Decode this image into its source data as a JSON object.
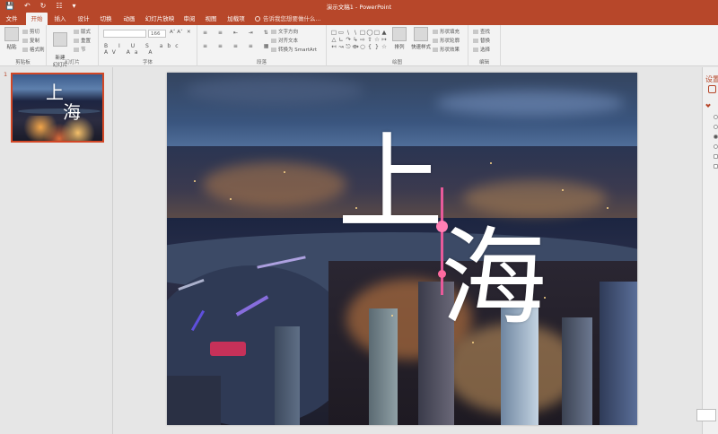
{
  "window": {
    "title": "演示文稿1 - PowerPoint",
    "qat": {
      "save_icon": "save-icon",
      "undo_icon": "undo-icon",
      "redo_icon": "redo-icon",
      "customize_icon": "chevron-down-icon"
    }
  },
  "tabs": [
    {
      "label": "文件",
      "active": false
    },
    {
      "label": "开始",
      "active": true
    },
    {
      "label": "插入",
      "active": false
    },
    {
      "label": "设计",
      "active": false
    },
    {
      "label": "切换",
      "active": false
    },
    {
      "label": "动画",
      "active": false
    },
    {
      "label": "幻灯片放映",
      "active": false
    },
    {
      "label": "审阅",
      "active": false
    },
    {
      "label": "视图",
      "active": false
    },
    {
      "label": "加载项",
      "active": false
    }
  ],
  "tell_me": "告诉我您想要做什么...",
  "ribbon": {
    "clipboard": {
      "label": "剪贴板",
      "paste": "粘贴",
      "cut": "剪切",
      "copy": "复制",
      "format_painter": "格式刷"
    },
    "slides": {
      "label": "幻灯片",
      "new_slide": "新建\n幻灯片",
      "layout": "版式",
      "reset": "重置",
      "section": "节"
    },
    "font": {
      "label": "字体",
      "font_name": "",
      "font_size": "166"
    },
    "paragraph": {
      "label": "段落",
      "text_direction": "文字方向",
      "align_text": "对齐文本",
      "smartart": "转换为 SmartArt"
    },
    "drawing": {
      "label": "绘图",
      "arrange": "排列",
      "quick_styles": "快速样式",
      "shape_fill": "形状填充",
      "shape_outline": "形状轮廓",
      "shape_effects": "形状效果"
    },
    "editing": {
      "label": "编辑",
      "find": "查找",
      "replace": "替换",
      "select": "选择"
    }
  },
  "slides_pane": {
    "slide_number": "1"
  },
  "slide": {
    "char1": "上",
    "char2": "海"
  },
  "format_pane": {
    "title": "设置"
  },
  "status": {
    "fit_button": "",
    "colors": {
      "accent": "#b7472a",
      "thumb_border": "#d24726"
    }
  }
}
